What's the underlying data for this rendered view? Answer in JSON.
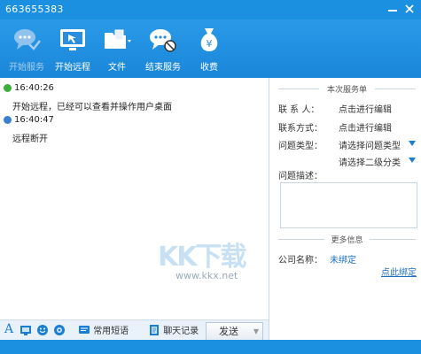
{
  "window": {
    "title": "663655383",
    "minimize_icon": "minimize-icon",
    "close_icon": "close-icon"
  },
  "toolbar": [
    {
      "label": "开始服务",
      "icon": "chat-bubble-icon",
      "disabled": true
    },
    {
      "label": "开始远程",
      "icon": "remote-screen-icon",
      "disabled": false
    },
    {
      "label": "文件",
      "icon": "folder-icon",
      "disabled": false
    },
    {
      "label": "结束服务",
      "icon": "end-service-icon",
      "disabled": false
    },
    {
      "label": "收费",
      "icon": "money-bag-icon",
      "disabled": false
    }
  ],
  "messages": [
    {
      "time": "16:40:26",
      "text": "开始远程，已经可以查看并操作用户桌面",
      "status_color": "#3cae3c"
    },
    {
      "time": "16:40:47",
      "text": "远程断开",
      "status_color": "#3b7fcf"
    }
  ],
  "input_toolbar": {
    "font_label": "A",
    "phrases_label": "常用短语",
    "history_label": "聊天记录",
    "send_label": "发送"
  },
  "service_form": {
    "section_title": "本次服务单",
    "contact_label": "联 系 人：",
    "contact_value": "点击进行编辑",
    "method_label": "联系方式：",
    "method_value": "点击进行编辑",
    "type_label": "问题类型：",
    "type_value": "请选择问题类型",
    "subtype_value": "请选择二级分类",
    "desc_label": "问题描述："
  },
  "more_info": {
    "section_title": "更多信息",
    "company_label": "公司名称：",
    "company_value": "未绑定",
    "bind_link": "点此绑定"
  },
  "watermark": {
    "big": "KK下载",
    "small": "www.kkx.net"
  },
  "colors": {
    "title_bar": "#1b8fe0",
    "link": "#1f6fc0",
    "accent": "#1a7fd4"
  }
}
